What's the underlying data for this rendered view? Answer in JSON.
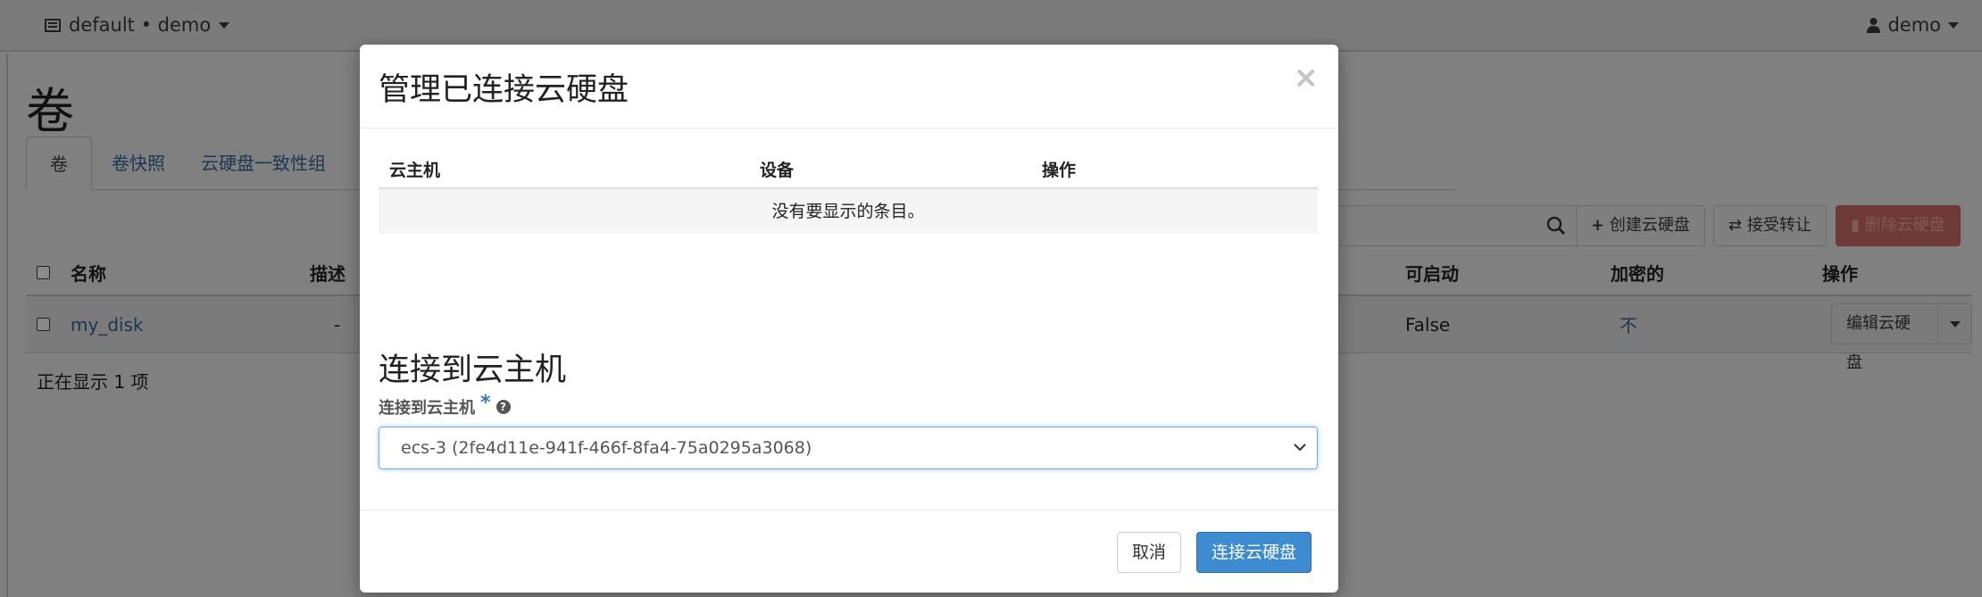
{
  "topbar": {
    "project": "default • demo",
    "user": "demo"
  },
  "page": {
    "title": "卷"
  },
  "tabs": [
    {
      "label": "卷"
    },
    {
      "label": "卷快照"
    },
    {
      "label": "云硬盘一致性组"
    }
  ],
  "toolbar": {
    "create_label": "创建云硬盘",
    "accept_transfer_label": "接受转让",
    "delete_label": "删除云硬盘"
  },
  "table": {
    "columns": {
      "name": "名称",
      "description": "描述",
      "bootable": "可启动",
      "encrypted": "加密的",
      "actions": "操作"
    },
    "rows": [
      {
        "name": "my_disk",
        "description": "-",
        "bootable": "False",
        "encrypted": "不",
        "action": "编辑云硬盘"
      }
    ],
    "count_text": "正在显示 1 项"
  },
  "modal": {
    "title": "管理已连接云硬盘",
    "close_glyph": "×",
    "attachments": {
      "columns": [
        "云主机",
        "设备",
        "操作"
      ],
      "empty_text": "没有要显示的条目。"
    },
    "attach_section_title": "连接到云主机",
    "field_label": "连接到云主机",
    "required_mark": "*",
    "help_glyph": "?",
    "selected_instance": "ecs-3 (2fe4d11e-941f-466f-8fa4-75a0295a3068)",
    "cancel_label": "取消",
    "submit_label": "连接云硬盘"
  },
  "colors": {
    "primary": "#3d8bd0",
    "link": "#337ab7",
    "danger": "#d9534f"
  }
}
